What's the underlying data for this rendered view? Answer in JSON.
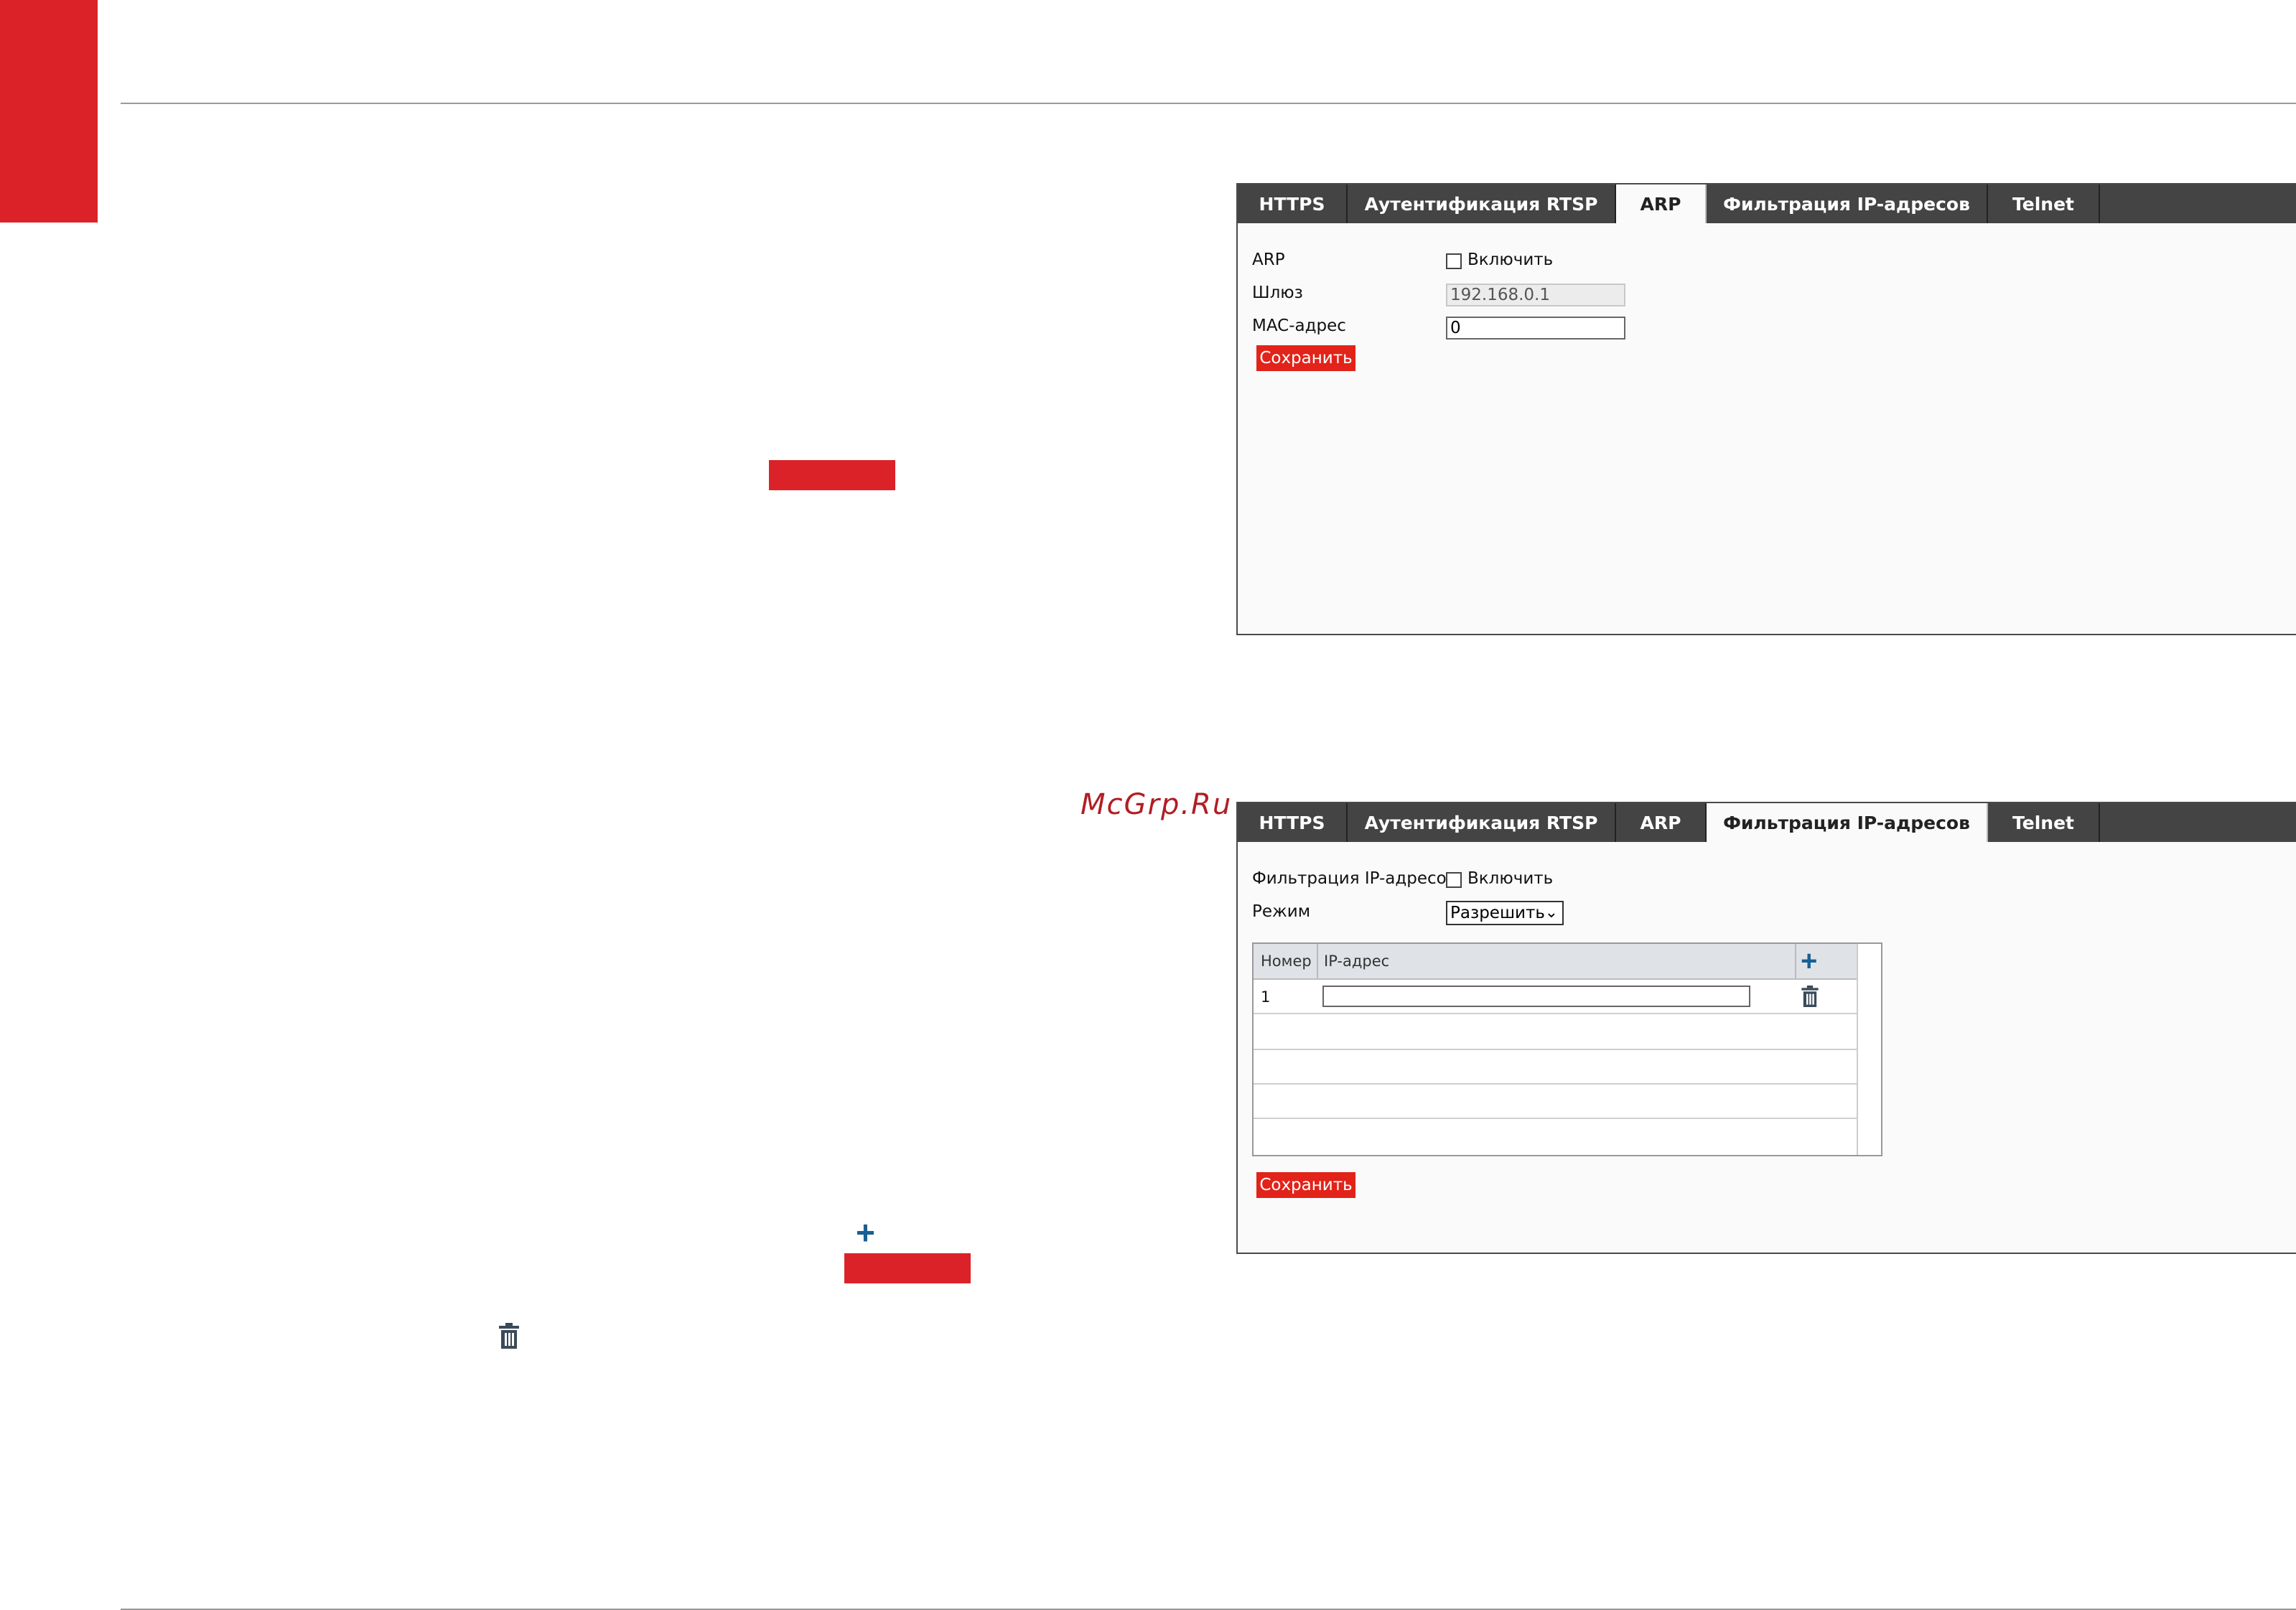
{
  "watermark": "McGrp.Ru",
  "tabs": [
    "HTTPS",
    "Аутентификация RTSP",
    "ARP",
    "Фильтрация IP-адресов",
    "Telnet"
  ],
  "arp_panel": {
    "active_tab": "ARP",
    "arp_label": "ARP",
    "enable_label": "Включить",
    "enable_checked": false,
    "gateway_label": "Шлюз",
    "gateway_value": "192.168.0.1",
    "mac_label": "MAC-адрес",
    "mac_value": "0",
    "save_label": "Сохранить"
  },
  "ipf_panel": {
    "active_tab": "Фильтрация IP-адресов",
    "filter_label": "Фильтрация IP-адресов",
    "enable_label": "Включить",
    "enable_checked": false,
    "mode_label": "Режим",
    "mode_value": "Разрешить",
    "table": {
      "col_number": "Номер",
      "col_ip": "IP-адрес",
      "rows": [
        {
          "number": "1",
          "ip": ""
        }
      ]
    },
    "save_label": "Сохранить"
  },
  "colors": {
    "accent_red": "#dc2229",
    "button_red": "#e2231a",
    "tab_dark": "#444444",
    "icon_blue": "#1a5f93"
  },
  "icons": [
    "plus-icon",
    "trash-icon"
  ]
}
